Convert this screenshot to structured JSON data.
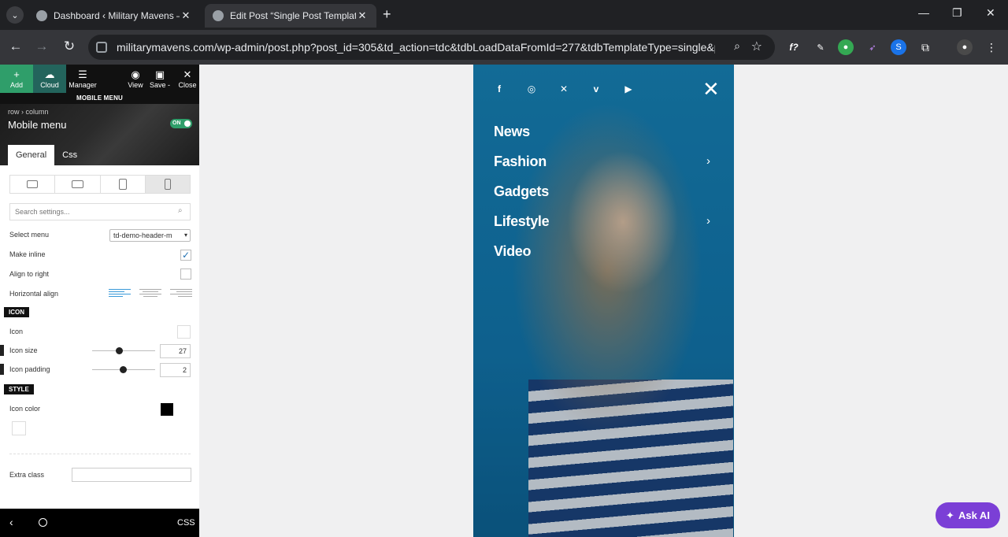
{
  "browser": {
    "tabs": [
      {
        "title": "Dashboard ‹ Military Mavens —",
        "active": false
      },
      {
        "title": "Edit Post “Single Post Template",
        "active": true
      }
    ],
    "url": "militarymavens.com/wp-admin/post.php?post_id=305&td_action=tdc&tdbLoadDataFromId=277&tdbTemplateType=single&prev_..."
  },
  "editor": {
    "toolbar": {
      "add": "Add",
      "cloud": "Cloud",
      "manager": "Manager",
      "view": "View",
      "save": "Save -",
      "close": "Close"
    },
    "section_title": "MOBILE MENU",
    "breadcrumb": "row › column",
    "element_title": "Mobile menu",
    "toggle": "ON",
    "tabs": [
      "General",
      "Css"
    ],
    "search_placeholder": "Search settings...",
    "settings": {
      "select_menu_label": "Select menu",
      "select_menu_value": "td-demo-header-m",
      "make_inline_label": "Make inline",
      "make_inline_checked": true,
      "align_right_label": "Align to right",
      "align_right_checked": false,
      "horizontal_align_label": "Horizontal align",
      "icon_section": "ICON",
      "icon_label": "Icon",
      "icon_size_label": "Icon size",
      "icon_size_value": "27",
      "icon_padding_label": "Icon padding",
      "icon_padding_value": "2",
      "style_section": "STYLE",
      "icon_color_label": "Icon color",
      "icon_color": "#000000",
      "extra_class_label": "Extra class"
    },
    "bottom": {
      "css": "CSS"
    }
  },
  "preview": {
    "social_icons": [
      "facebook-icon",
      "instagram-icon",
      "x-icon",
      "vimeo-icon",
      "youtube-icon"
    ],
    "menu": [
      {
        "label": "News",
        "has_children": false
      },
      {
        "label": "Fashion",
        "has_children": true
      },
      {
        "label": "Gadgets",
        "has_children": false
      },
      {
        "label": "Lifestyle",
        "has_children": true
      },
      {
        "label": "Video",
        "has_children": false
      }
    ]
  },
  "ask_ai": "Ask AI",
  "colors": {
    "accent_green": "#2f9e6a",
    "ask_ai_purple": "#7b3fd6"
  }
}
